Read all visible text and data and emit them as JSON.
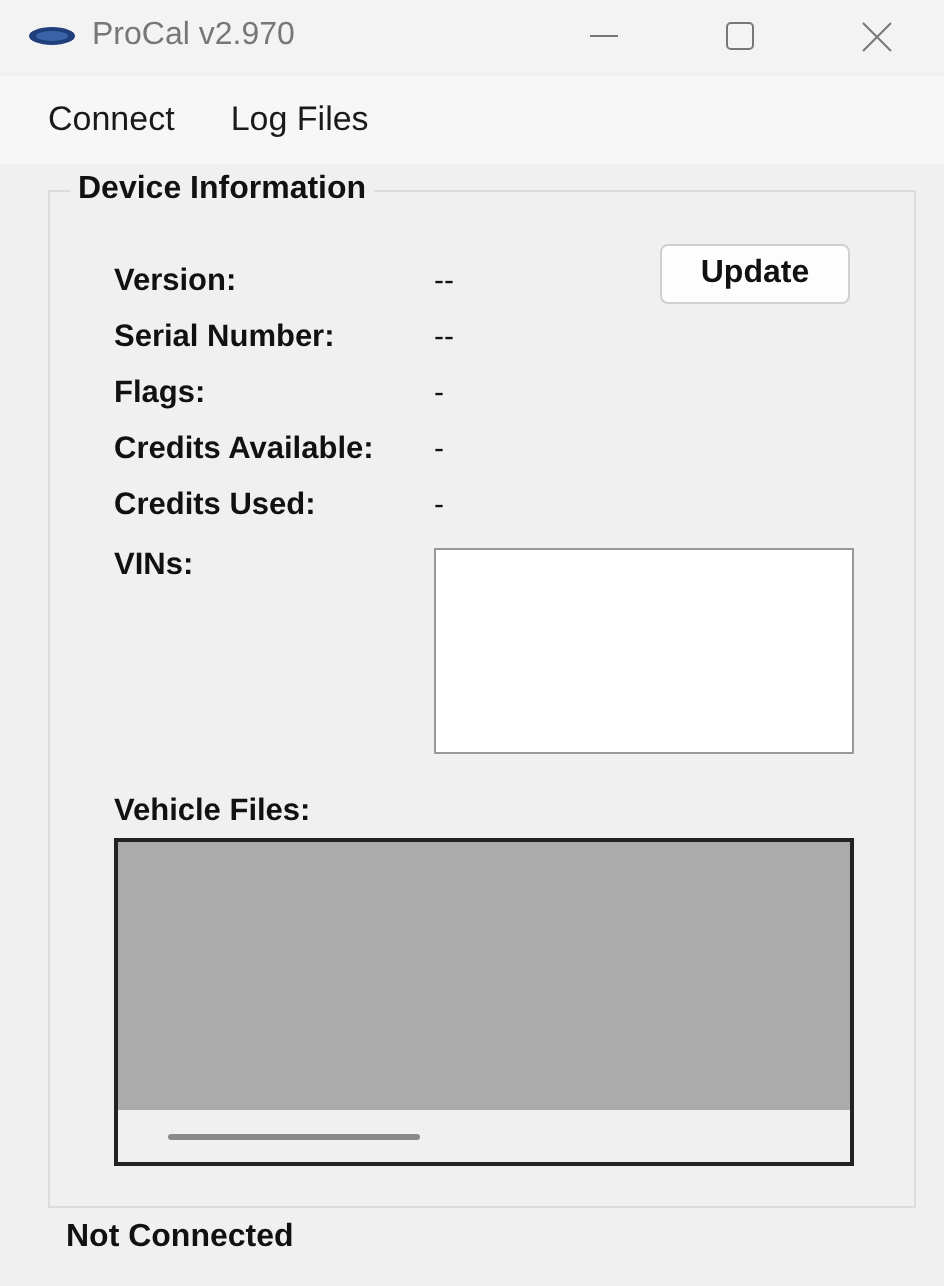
{
  "window": {
    "title": "ProCal v2.970"
  },
  "menu": [
    "Connect",
    "Log Files"
  ],
  "device_information": {
    "title": "Device Information",
    "update_button": "Update",
    "fields": [
      {
        "label": "Version:",
        "value": "--"
      },
      {
        "label": "Serial Number:",
        "value": "--"
      },
      {
        "label": "Flags:",
        "value": "-"
      },
      {
        "label": "Credits Available:",
        "value": "-"
      },
      {
        "label": "Credits Used:",
        "value": "-"
      }
    ],
    "vins_label": "VINs:",
    "vehicle_files_label": "Vehicle Files:"
  },
  "status_bar": "Not Connected"
}
